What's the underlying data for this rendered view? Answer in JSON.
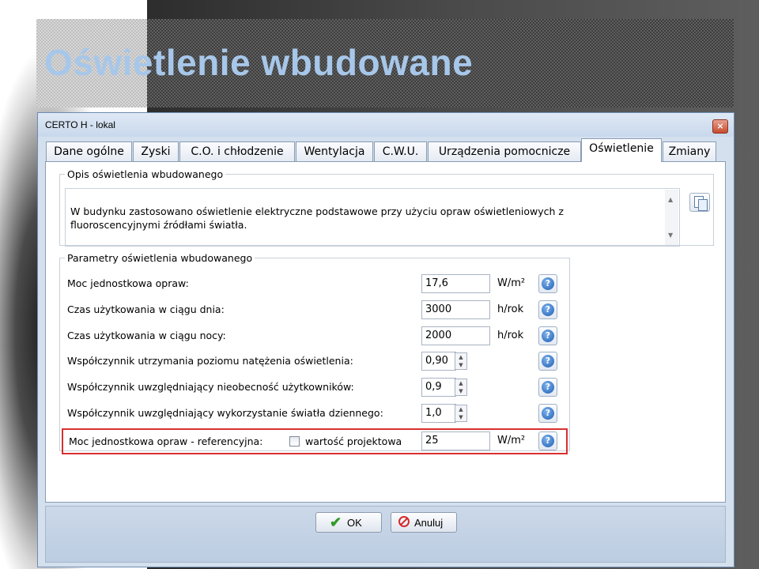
{
  "slide": {
    "title": "Oświetlenie wbudowane"
  },
  "window": {
    "title": "CERTO H - lokal",
    "close_glyph": "×"
  },
  "tabs": [
    {
      "label": "Dane ogólne",
      "active": false
    },
    {
      "label": "Zyski",
      "active": false
    },
    {
      "label": "C.O. i chłodzenie",
      "active": false
    },
    {
      "label": "Wentylacja",
      "active": false
    },
    {
      "label": "C.W.U.",
      "active": false
    },
    {
      "label": "Urządzenia pomocnicze",
      "active": false
    },
    {
      "label": "Oświetlenie",
      "active": true
    },
    {
      "label": "Zmiany",
      "active": false
    }
  ],
  "description": {
    "legend": "Opis oświetlenia wbudowanego",
    "text": "W budynku zastosowano oświetlenie elektryczne podstawowe przy użyciu opraw oświetleniowych z\nfluoroscencyjnymi źródłami światła."
  },
  "params": {
    "legend": "Parametry oświetlenia wbudowanego",
    "rows": [
      {
        "label": "Moc jednostkowa opraw:",
        "value": "17,6",
        "unit": "W/m²"
      },
      {
        "label": "Czas użytkowania w ciągu dnia:",
        "value": "3000",
        "unit": "h/rok"
      },
      {
        "label": "Czas użytkowania w ciągu nocy:",
        "value": "2000",
        "unit": "h/rok"
      },
      {
        "label": "Współczynnik utrzymania poziomu natężenia oświetlenia:",
        "value": "0,90",
        "unit": ""
      },
      {
        "label": "Współczynnik uwzględniający nieobecność użytkowników:",
        "value": "0,9",
        "unit": ""
      },
      {
        "label": "Współczynnik uwzględniający wykorzystanie światła dziennego:",
        "value": "1,0",
        "unit": ""
      }
    ],
    "reference": {
      "label": "Moc jednostkowa opraw - referencyjna:",
      "checkbox_label": "wartość projektowa",
      "checked": false,
      "value": "25",
      "unit": "W/m²"
    }
  },
  "help_glyph": "?",
  "buttons": {
    "ok": "OK",
    "cancel": "Anuluj"
  },
  "colors": {
    "highlight_border": "#d9302f",
    "title": "#a7c7ea"
  }
}
